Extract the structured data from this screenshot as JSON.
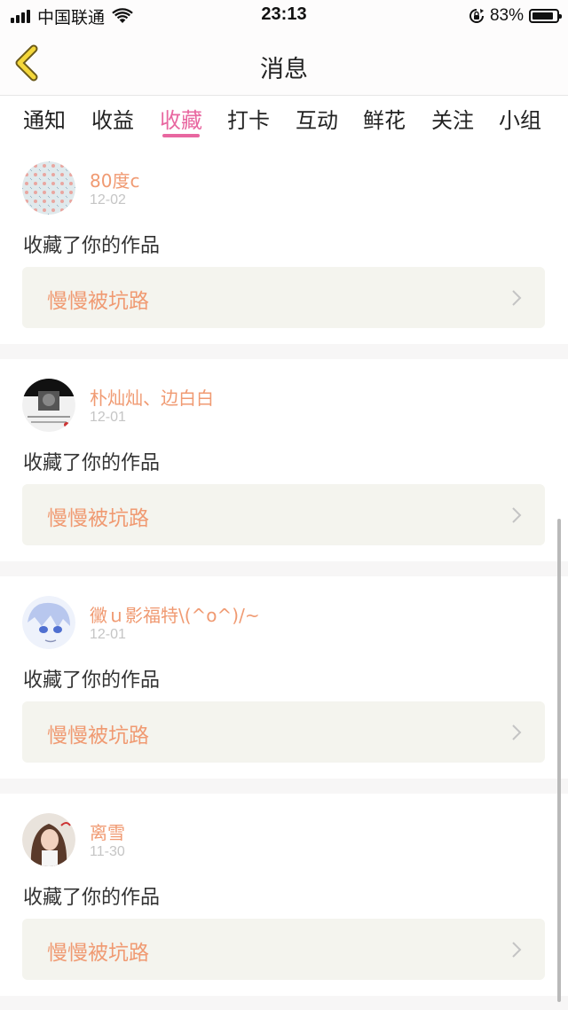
{
  "status_bar": {
    "carrier": "中国联通",
    "time": "23:13",
    "battery": "83%",
    "battery_level": 0.83
  },
  "nav": {
    "title": "消息",
    "back_icon": "chevron-left-icon"
  },
  "tabs": [
    {
      "label": "通知"
    },
    {
      "label": "收益"
    },
    {
      "label": "收藏",
      "active": true
    },
    {
      "label": "打卡"
    },
    {
      "label": "互动"
    },
    {
      "label": "鲜花"
    },
    {
      "label": "关注"
    },
    {
      "label": "小组"
    }
  ],
  "items": [
    {
      "user": "80度c",
      "date": "12-02",
      "action": "收藏了你的作品",
      "work": "慢慢被坑路"
    },
    {
      "user": "朴灿灿、边白白",
      "date": "12-01",
      "action": "收藏了你的作品",
      "work": "慢慢被坑路"
    },
    {
      "user": "黴ｕ影福特\\(^o^)/~",
      "date": "12-01",
      "action": "收藏了你的作品",
      "work": "慢慢被坑路"
    },
    {
      "user": "离雪",
      "date": "11-30",
      "action": "收藏了你的作品",
      "work": "慢慢被坑路"
    }
  ],
  "colors": {
    "accent": "#e867a0",
    "username": "#f09a72",
    "work_bg": "#f4f4ee"
  }
}
